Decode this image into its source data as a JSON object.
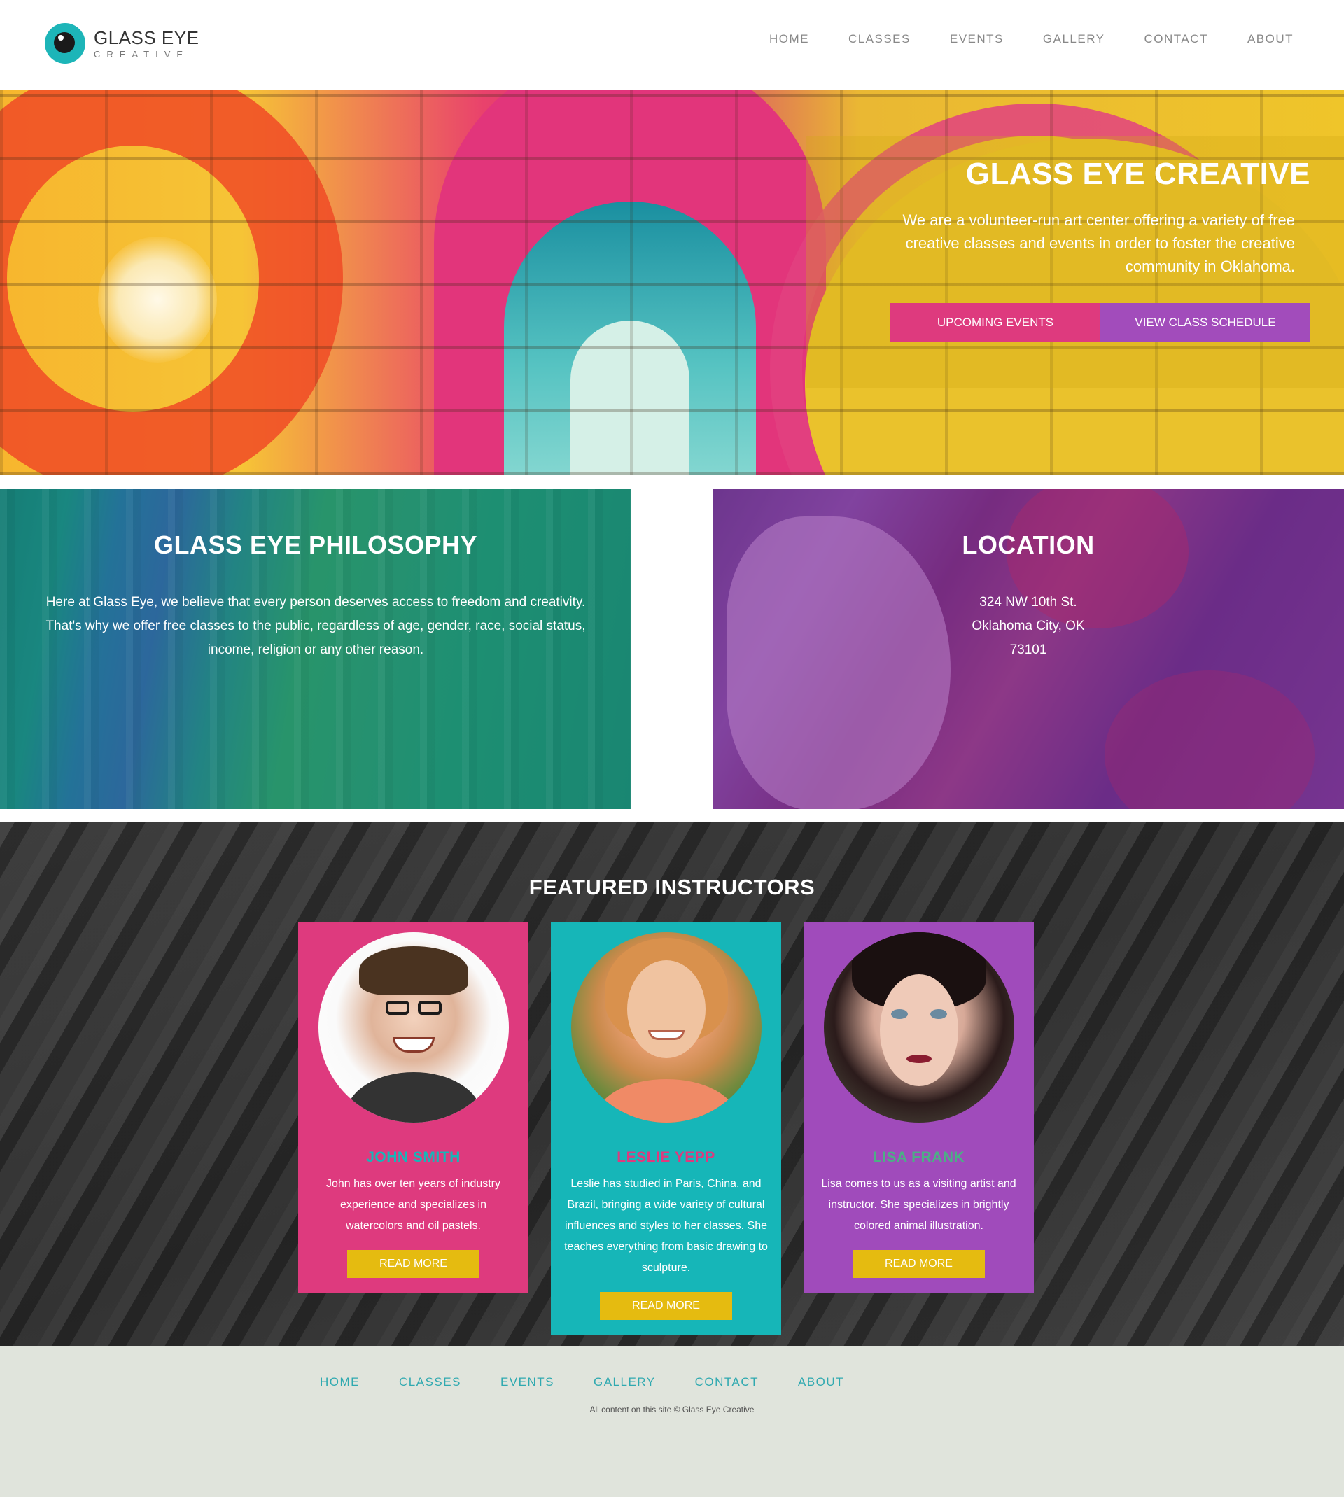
{
  "brand": {
    "title": "GLASS EYE",
    "subtitle": "CREATIVE"
  },
  "nav": [
    "HOME",
    "CLASSES",
    "EVENTS",
    "GALLERY",
    "CONTACT",
    "ABOUT"
  ],
  "hero": {
    "title": "GLASS EYE CREATIVE",
    "description": "We are a volunteer-run art center offering a variety of free creative classes and events in order to foster the creative community in Oklahoma.",
    "btn_events": "UPCOMING EVENTS",
    "btn_schedule": "VIEW CLASS SCHEDULE"
  },
  "philosophy": {
    "title": "GLASS EYE PHILOSOPHY",
    "text": "Here at Glass Eye, we believe that every person deserves access to freedom and creativity. That's why we offer free classes to the public, regardless of age, gender, race, social status, income, religion or any other reason."
  },
  "location": {
    "title": "LOCATION",
    "line1": "324 NW 10th St.",
    "line2": "Oklahoma City, OK",
    "line3": "73101"
  },
  "instructors": {
    "title": "FEATURED INSTRUCTORS",
    "cards": [
      {
        "name": "JOHN SMITH",
        "bio": "John has over ten years of industry experience and specializes in watercolors and oil pastels.",
        "button": "READ MORE"
      },
      {
        "name": "LESLIE YEPP",
        "bio": "Leslie has studied in Paris, China, and Brazil, bringing a wide variety of cultural influences and styles to her classes. She teaches everything from basic drawing to sculpture.",
        "button": "READ MORE"
      },
      {
        "name": "LISA FRANK",
        "bio": "Lisa comes to us as a visiting artist and instructor. She specializes in brightly colored animal illustration.",
        "button": "READ MORE"
      }
    ]
  },
  "footer": {
    "nav": [
      "HOME",
      "CLASSES",
      "EVENTS",
      "GALLERY",
      "CONTACT",
      "ABOUT"
    ],
    "copyright": "All content on this site © Glass Eye Creative"
  },
  "colors": {
    "teal": "#16b6b8",
    "pink": "#de3a7e",
    "purple": "#a04bbb",
    "yellow": "#e5bb10",
    "footer_bg": "#e0e4dc"
  },
  "icons": [
    "logo-eye-icon"
  ]
}
